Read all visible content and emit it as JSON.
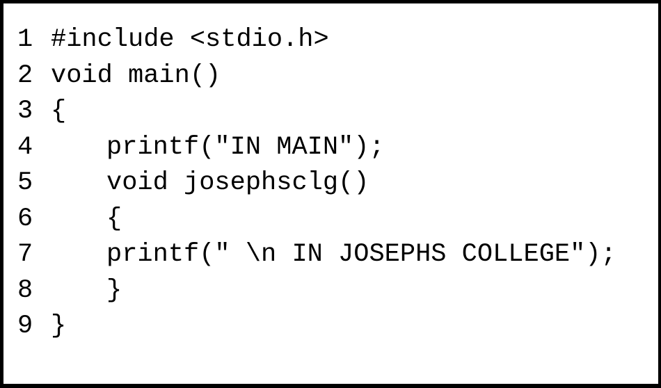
{
  "code": {
    "lines": [
      {
        "number": "1",
        "text": "#include <stdio.h>"
      },
      {
        "number": "2",
        "text": "void main()"
      },
      {
        "number": "3",
        "text": "{"
      },
      {
        "number": "4",
        "text": "printf(\"IN MAIN\");"
      },
      {
        "number": "5",
        "text": "void josephsclg()"
      },
      {
        "number": "6",
        "text": "{"
      },
      {
        "number": "7",
        "text": "printf(\" \\n IN JOSEPHS COLLEGE\");"
      },
      {
        "number": "8",
        "text": "}"
      },
      {
        "number": "9",
        "text": "}"
      }
    ]
  },
  "colors": {
    "background": "#ffffff",
    "text": "#000000",
    "border": "#000000"
  }
}
